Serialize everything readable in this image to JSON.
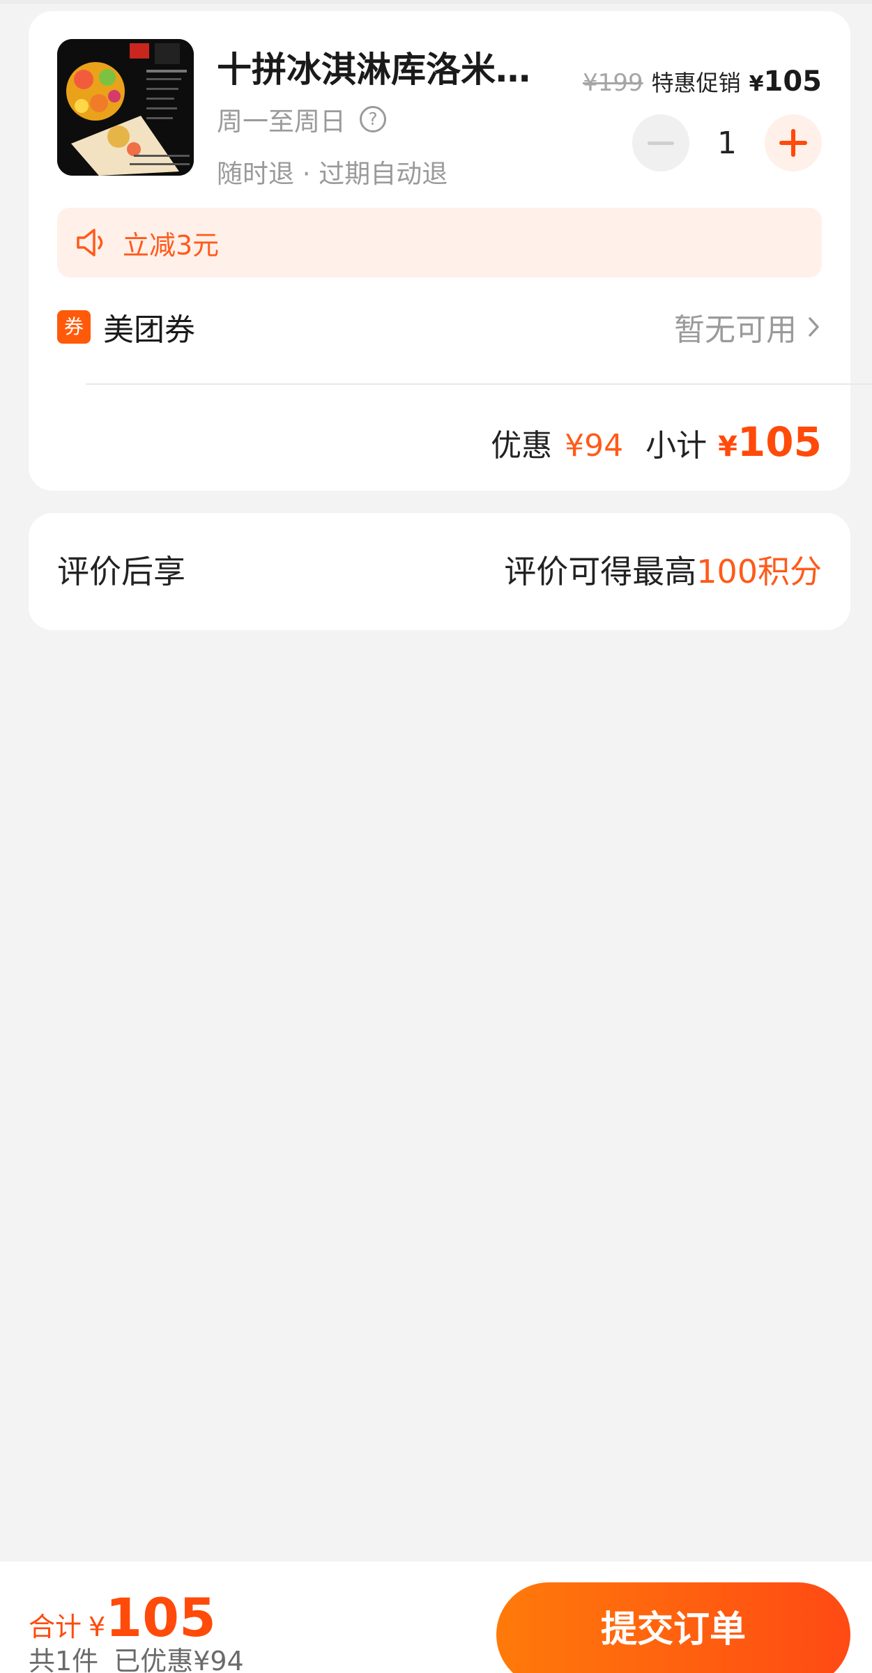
{
  "product": {
    "title": "十拼冰淇淋库洛米…",
    "schedule": "周一至周日",
    "refund": "随时退 · 过期自动退",
    "original_price": "¥199",
    "promo_label": "特惠促销",
    "price_yen": "¥",
    "price_value": "105",
    "quantity": "1"
  },
  "discount": {
    "text": "立减3元"
  },
  "coupon": {
    "icon_text": "券",
    "label": "美团券",
    "status": "暂无可用"
  },
  "summary": {
    "discount_label": "优惠",
    "discount_value": "¥94",
    "subtotal_label": "小计",
    "subtotal_yen": "¥",
    "subtotal_value": "105"
  },
  "review": {
    "left_label": "评价后享",
    "right_prefix": "评价可得最高",
    "right_highlight": "100积分"
  },
  "footer": {
    "total_label": "合计",
    "total_yen": "¥",
    "total_value": "105",
    "item_count": "共1件",
    "saved": "已优惠¥94",
    "submit_label": "提交订单"
  },
  "colors": {
    "accent": "#ff4a0a",
    "accent_light": "#fff0ea",
    "background": "#f3f3f3"
  },
  "icons": {
    "help": "question-circle-icon",
    "speaker": "speaker-icon",
    "chevron": "chevron-right-icon"
  }
}
